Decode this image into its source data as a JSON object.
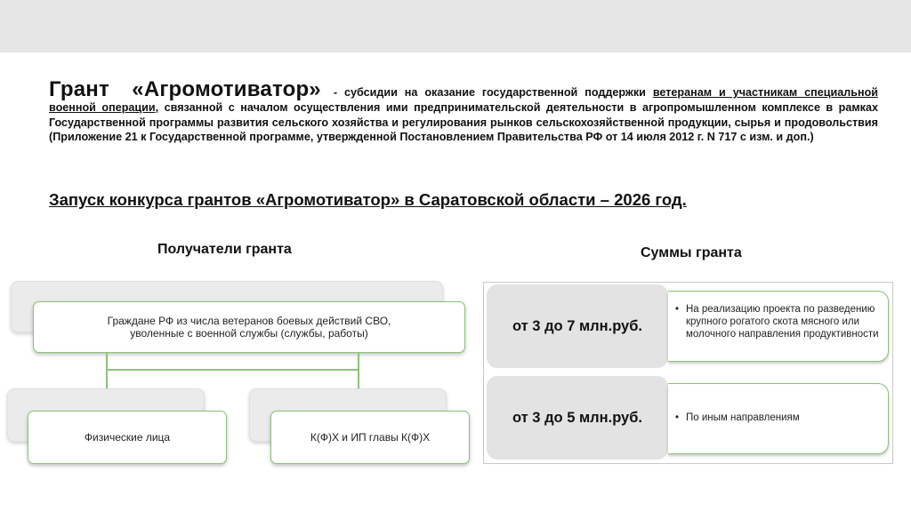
{
  "intro": {
    "grant_name": "Грант «Агромотиватор»",
    "dash_text": "- субсидии на оказание государственной поддержки",
    "underlined_text": "ветеранам и участникам специальной военной операции",
    "rest_text": ", связанной с началом осуществления ими предпринимательской деятельности в агропромышленном комплексе в рамках Государственной программы развития сельского хозяйства и регулирования рынков сельскохозяйственной продукции, сырья и продовольствия (Приложение 21 к Государственной программе, утвержденной Постановлением Правительства РФ от 14 июля 2012 г. N 717 с изм. и доп.)"
  },
  "launch_heading": "Запуск конкурса грантов «Агромотиватор» в Саратовской области – 2026 год.",
  "recipients": {
    "title": "Получатели гранта",
    "top_node": "Граждане РФ из числа ветеранов боевых действий СВО, уволенные с военной службы (службы, работы)",
    "left_node": "Физические лица",
    "right_node": "К(Ф)Х и ИП главы К(Ф)Х"
  },
  "amounts": {
    "title": "Суммы гранта",
    "rows": [
      {
        "amount": "от 3 до 7 млн.руб.",
        "description": "На реализацию проекта по разведению крупного рогатого скота мясного или молочного направления продуктивности"
      },
      {
        "amount": "от 3 до 5 млн.руб.",
        "description": "По иным направлениям"
      }
    ]
  },
  "colors": {
    "accent_green": "#8cc37a",
    "amount_cell_bg": "#e3e3e3",
    "top_band": "#e6e6e6"
  }
}
